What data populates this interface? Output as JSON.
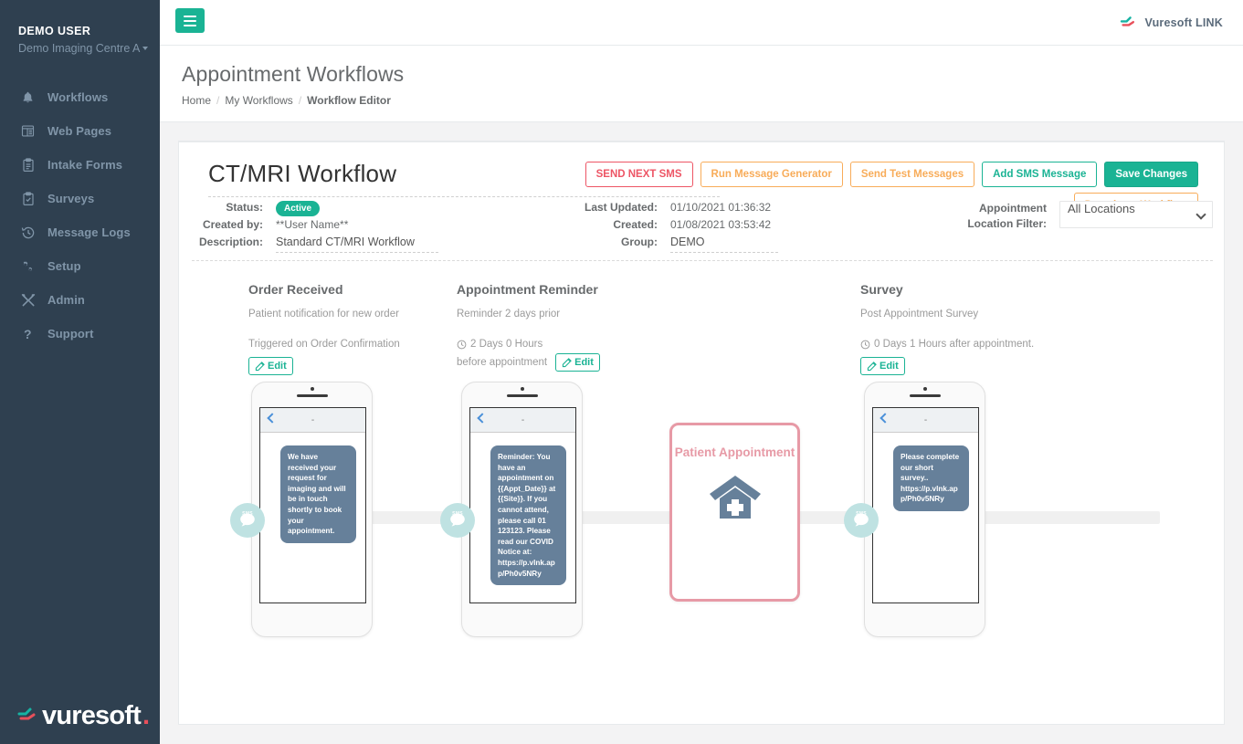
{
  "sidebar": {
    "user_name": "DEMO USER",
    "org_name": "Demo Imaging Centre A",
    "items": [
      {
        "label": "Workflows",
        "icon": "bell-icon"
      },
      {
        "label": "Web Pages",
        "icon": "browser-icon"
      },
      {
        "label": "Intake Forms",
        "icon": "clipboard-icon"
      },
      {
        "label": "Surveys",
        "icon": "clipboard-check-icon"
      },
      {
        "label": "Message Logs",
        "icon": "history-icon"
      },
      {
        "label": "Setup",
        "icon": "cogs-icon"
      },
      {
        "label": "Admin",
        "icon": "tools-icon"
      },
      {
        "label": "Support",
        "icon": "question-icon"
      }
    ],
    "footer_logo": "vuresoft",
    "footer_logo_dot": "."
  },
  "topbar": {
    "brand_text": "Vuresoft LINK",
    "hamburger_label": "Toggle navigation"
  },
  "pagehead": {
    "title": "Appointment Workflows",
    "breadcrumb": [
      {
        "label": "Home",
        "active": false
      },
      {
        "label": "My Workflows",
        "active": false
      },
      {
        "label": "Workflow Editor",
        "active": true
      }
    ],
    "separator": "/"
  },
  "workflow": {
    "title": "CT/MRI Workflow",
    "buttons": {
      "send_next_sms": "SEND NEXT SMS",
      "run_message_generator": "Run Message Generator",
      "send_test_messages": "Send Test Messages",
      "add_sms_message": "Add SMS Message",
      "save_changes": "Save Changes",
      "deactivate_workflow": "Deactivate Workflow"
    },
    "meta": {
      "status_label": "Status:",
      "status_value": "Active",
      "created_by_label": "Created by:",
      "created_by_value": "**User Name**",
      "description_label": "Description:",
      "description_value": "Standard CT/MRI Workflow",
      "last_updated_label": "Last Updated:",
      "last_updated_value": "01/10/2021 01:36:32",
      "created_label": "Created:",
      "created_value": "01/08/2021 03:53:42",
      "group_label": "Group:",
      "group_value": "DEMO",
      "location_filter_label_line1": "Appointment",
      "location_filter_label_line2": "Location Filter:",
      "location_filter_value": "All Locations",
      "location_filter_options": [
        "All Locations"
      ]
    }
  },
  "flow": {
    "edit_label": "Edit",
    "sms_badge_label": "SMS",
    "phone_nav_title": "-",
    "steps": [
      {
        "title": "Order Received",
        "subtitle": "Patient notification for new order",
        "trigger": "Triggered on Order Confirmation",
        "trigger_has_clock": false,
        "trigger_suffix": "",
        "message": "We have received your request for imaging and will be in touch shortly to book your appointment."
      },
      {
        "title": "Appointment Reminder",
        "subtitle": "Reminder 2 days prior",
        "trigger": "2 Days 0 Hours",
        "trigger_has_clock": true,
        "trigger_suffix": "before appointment",
        "message": "Reminder: You have an appointment on {{Appt_Date}} at {{Site}}. If you cannot attend, please call 01 123123. Please read our COVID Notice at: https://p.vlnk.app/Ph0v5NRy"
      },
      {
        "title": "Survey",
        "subtitle": "Post Appointment Survey",
        "trigger": "0 Days 1 Hours after appointment.",
        "trigger_has_clock": true,
        "trigger_suffix": "",
        "message": "Please complete our short survey.. https://p.vlnk.app/Ph0v5NRy"
      }
    ],
    "appointment_card": {
      "title": "Patient Appointment",
      "icon": "hospital-icon"
    }
  },
  "colors": {
    "sidebar_bg": "#2f4050",
    "accent_teal": "#1ab394",
    "danger_red": "#ed5565",
    "warn_orange": "#f8ac59",
    "appointment_pink": "#e79aa6",
    "bubble_slate": "#66809a",
    "sms_badge_teal": "#bfe2e2"
  }
}
